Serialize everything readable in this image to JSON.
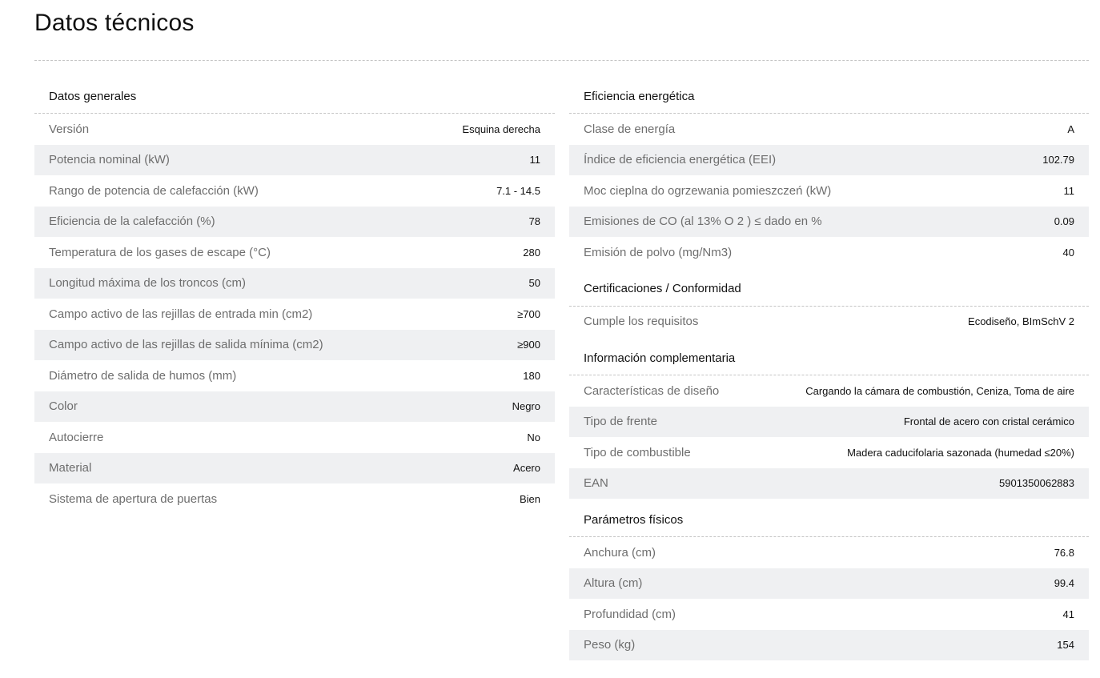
{
  "page": {
    "title": "Datos técnicos"
  },
  "colors": {
    "row_shade": "#eff0f2",
    "divider": "#c4c4c4",
    "label": "#6e6e6e",
    "value": "#111111"
  },
  "left": {
    "sections": [
      {
        "title": "Datos generales",
        "rows": [
          {
            "label": "Versión",
            "value": "Esquina derecha"
          },
          {
            "label": "Potencia nominal (kW)",
            "value": "11"
          },
          {
            "label": "Rango de potencia de calefacción (kW)",
            "value": "7.1 - 14.5"
          },
          {
            "label": "Eficiencia de la calefacción (%)",
            "value": "78"
          },
          {
            "label": "Temperatura de los gases de escape (°C)",
            "value": "280"
          },
          {
            "label": "Longitud máxima de los troncos (cm)",
            "value": "50"
          },
          {
            "label": "Campo activo de las rejillas de entrada min (cm2)",
            "value": "≥700"
          },
          {
            "label": "Campo activo de las rejillas de salida mínima (cm2)",
            "value": "≥900"
          },
          {
            "label": "Diámetro de salida de humos (mm)",
            "value": "180"
          },
          {
            "label": "Color",
            "value": "Negro"
          },
          {
            "label": "Autocierre",
            "value": "No"
          },
          {
            "label": "Material",
            "value": "Acero"
          },
          {
            "label": "Sistema de apertura de puertas",
            "value": "Bien"
          }
        ]
      }
    ]
  },
  "right": {
    "sections": [
      {
        "title": "Eficiencia energética",
        "rows": [
          {
            "label": "Clase de energía",
            "value": "A"
          },
          {
            "label": "Índice de eficiencia energética (EEI)",
            "value": "102.79"
          },
          {
            "label": "Moc cieplna do ogrzewania pomieszczeń (kW)",
            "value": "11"
          },
          {
            "label": "Emisiones de CO (al 13% O 2 ) ≤ dado en %",
            "value": "0.09"
          },
          {
            "label": "Emisión de polvo (mg/Nm3)",
            "value": "40"
          }
        ]
      },
      {
        "title": "Certificaciones / Conformidad",
        "rows": [
          {
            "label": "Cumple los requisitos",
            "value": "Ecodiseño, BImSchV 2"
          }
        ]
      },
      {
        "title": "Información complementaria",
        "rows": [
          {
            "label": "Características de diseño",
            "value": "Cargando la cámara de combustión, Ceniza, Toma de aire"
          },
          {
            "label": "Tipo de frente",
            "value": "Frontal de acero con cristal cerámico"
          },
          {
            "label": "Tipo de combustible",
            "value": "Madera caducifolaria sazonada (humedad ≤20%)"
          },
          {
            "label": "EAN",
            "value": "5901350062883"
          }
        ]
      },
      {
        "title": "Parámetros físicos",
        "rows": [
          {
            "label": "Anchura (cm)",
            "value": "76.8"
          },
          {
            "label": "Altura (cm)",
            "value": "99.4"
          },
          {
            "label": "Profundidad (cm)",
            "value": "41"
          },
          {
            "label": "Peso (kg)",
            "value": "154"
          }
        ]
      }
    ]
  }
}
